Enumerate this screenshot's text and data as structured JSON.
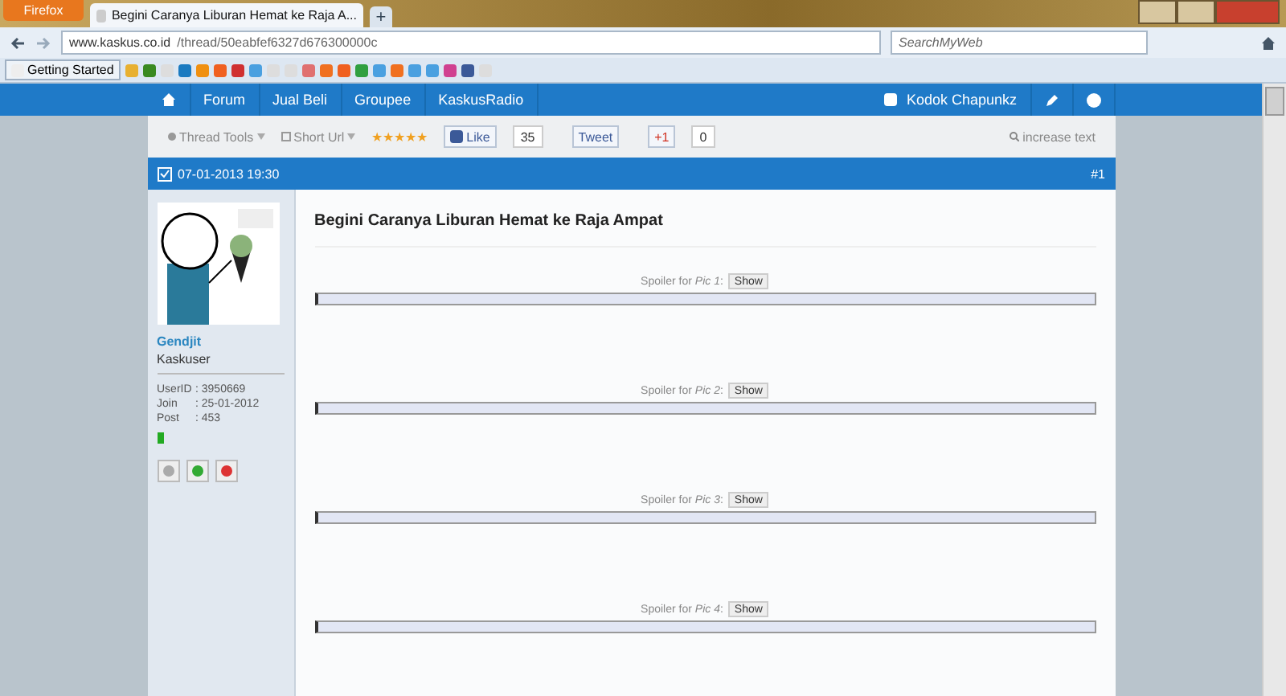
{
  "browser": {
    "app_button": "Firefox",
    "tab_title": "Begini Caranya Liburan Hemat ke Raja A...",
    "new_tab": "+",
    "url_host": "www.kaskus.co.id",
    "url_path": "/thread/50eabfef6327d676300000c",
    "search_placeholder": "SearchMyWeb",
    "bookmark": "Getting Started"
  },
  "nav": {
    "items": [
      {
        "label": "Forum"
      },
      {
        "label": "Jual Beli"
      },
      {
        "label": "Groupee"
      },
      {
        "label": "KaskusRadio"
      }
    ],
    "user": "Kodok Chapunkz"
  },
  "toolbar": {
    "thread_tools": "Thread Tools",
    "short_url": "Short Url",
    "stars": 5,
    "like": "Like",
    "like_count": "35",
    "tweet": "Tweet",
    "plus": "+1",
    "plus_count": "0",
    "increase_text": "increase text"
  },
  "post": {
    "date": "07-01-2013 19:30",
    "number": "#1",
    "title": "Begini Caranya Liburan Hemat ke Raja Ampat",
    "author": {
      "name": "Gendjit",
      "rank": "Kaskuser",
      "details": [
        {
          "label": "UserID",
          "value": ": 3950669"
        },
        {
          "label": "Join",
          "value": ": 25-01-2012"
        },
        {
          "label": "Post",
          "value": ": 453"
        }
      ]
    },
    "spoilers": [
      {
        "label": "Spoiler for *Pic 1*:",
        "button": "Show"
      },
      {
        "label": "Spoiler for *Pic 2*:",
        "button": "Show"
      },
      {
        "label": "Spoiler for *Pic 3*:",
        "button": "Show"
      },
      {
        "label": "Spoiler for *Pic 4*:",
        "button": "Show"
      }
    ]
  }
}
